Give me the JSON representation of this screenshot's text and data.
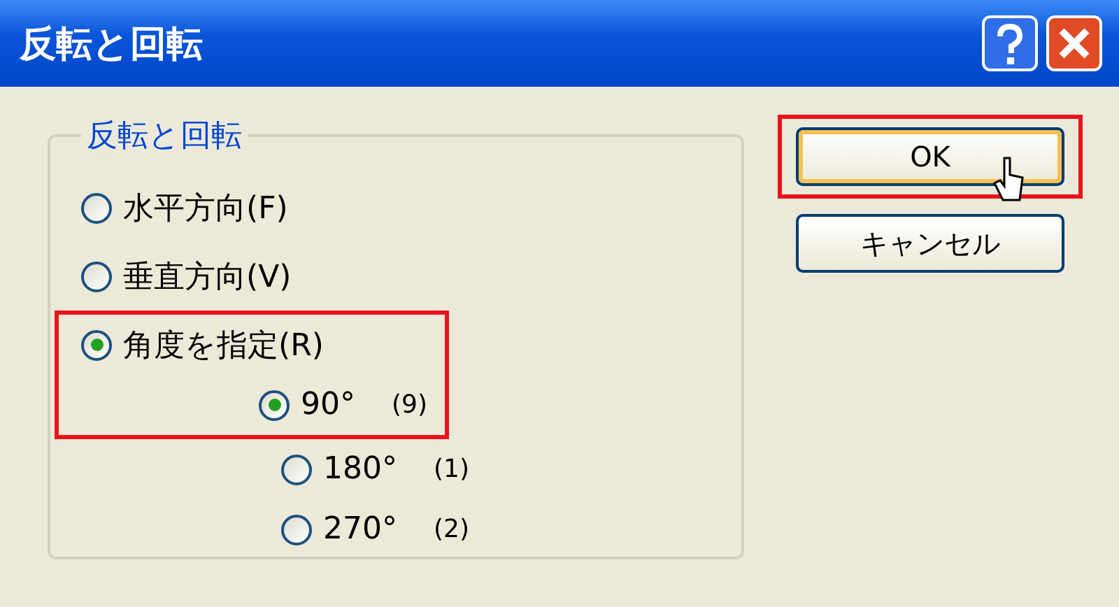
{
  "window": {
    "title": "反転と回転"
  },
  "group": {
    "title": "反転と回転",
    "options": [
      {
        "label": "水平方向(F)",
        "selected": false,
        "highlighted": false
      },
      {
        "label": "垂直方向(V)",
        "selected": false,
        "highlighted": false
      },
      {
        "label": "角度を指定(R)",
        "selected": true,
        "highlighted": true,
        "children": [
          {
            "label": "90°",
            "key": "(9)",
            "selected": true
          },
          {
            "label": "180°",
            "key": "(1)",
            "selected": false
          },
          {
            "label": "270°",
            "key": "(2)",
            "selected": false
          }
        ]
      }
    ]
  },
  "buttons": [
    {
      "label": "OK",
      "highlighted": true,
      "hovered": true
    },
    {
      "label": "キャンセル",
      "highlighted": false,
      "hovered": false
    }
  ]
}
